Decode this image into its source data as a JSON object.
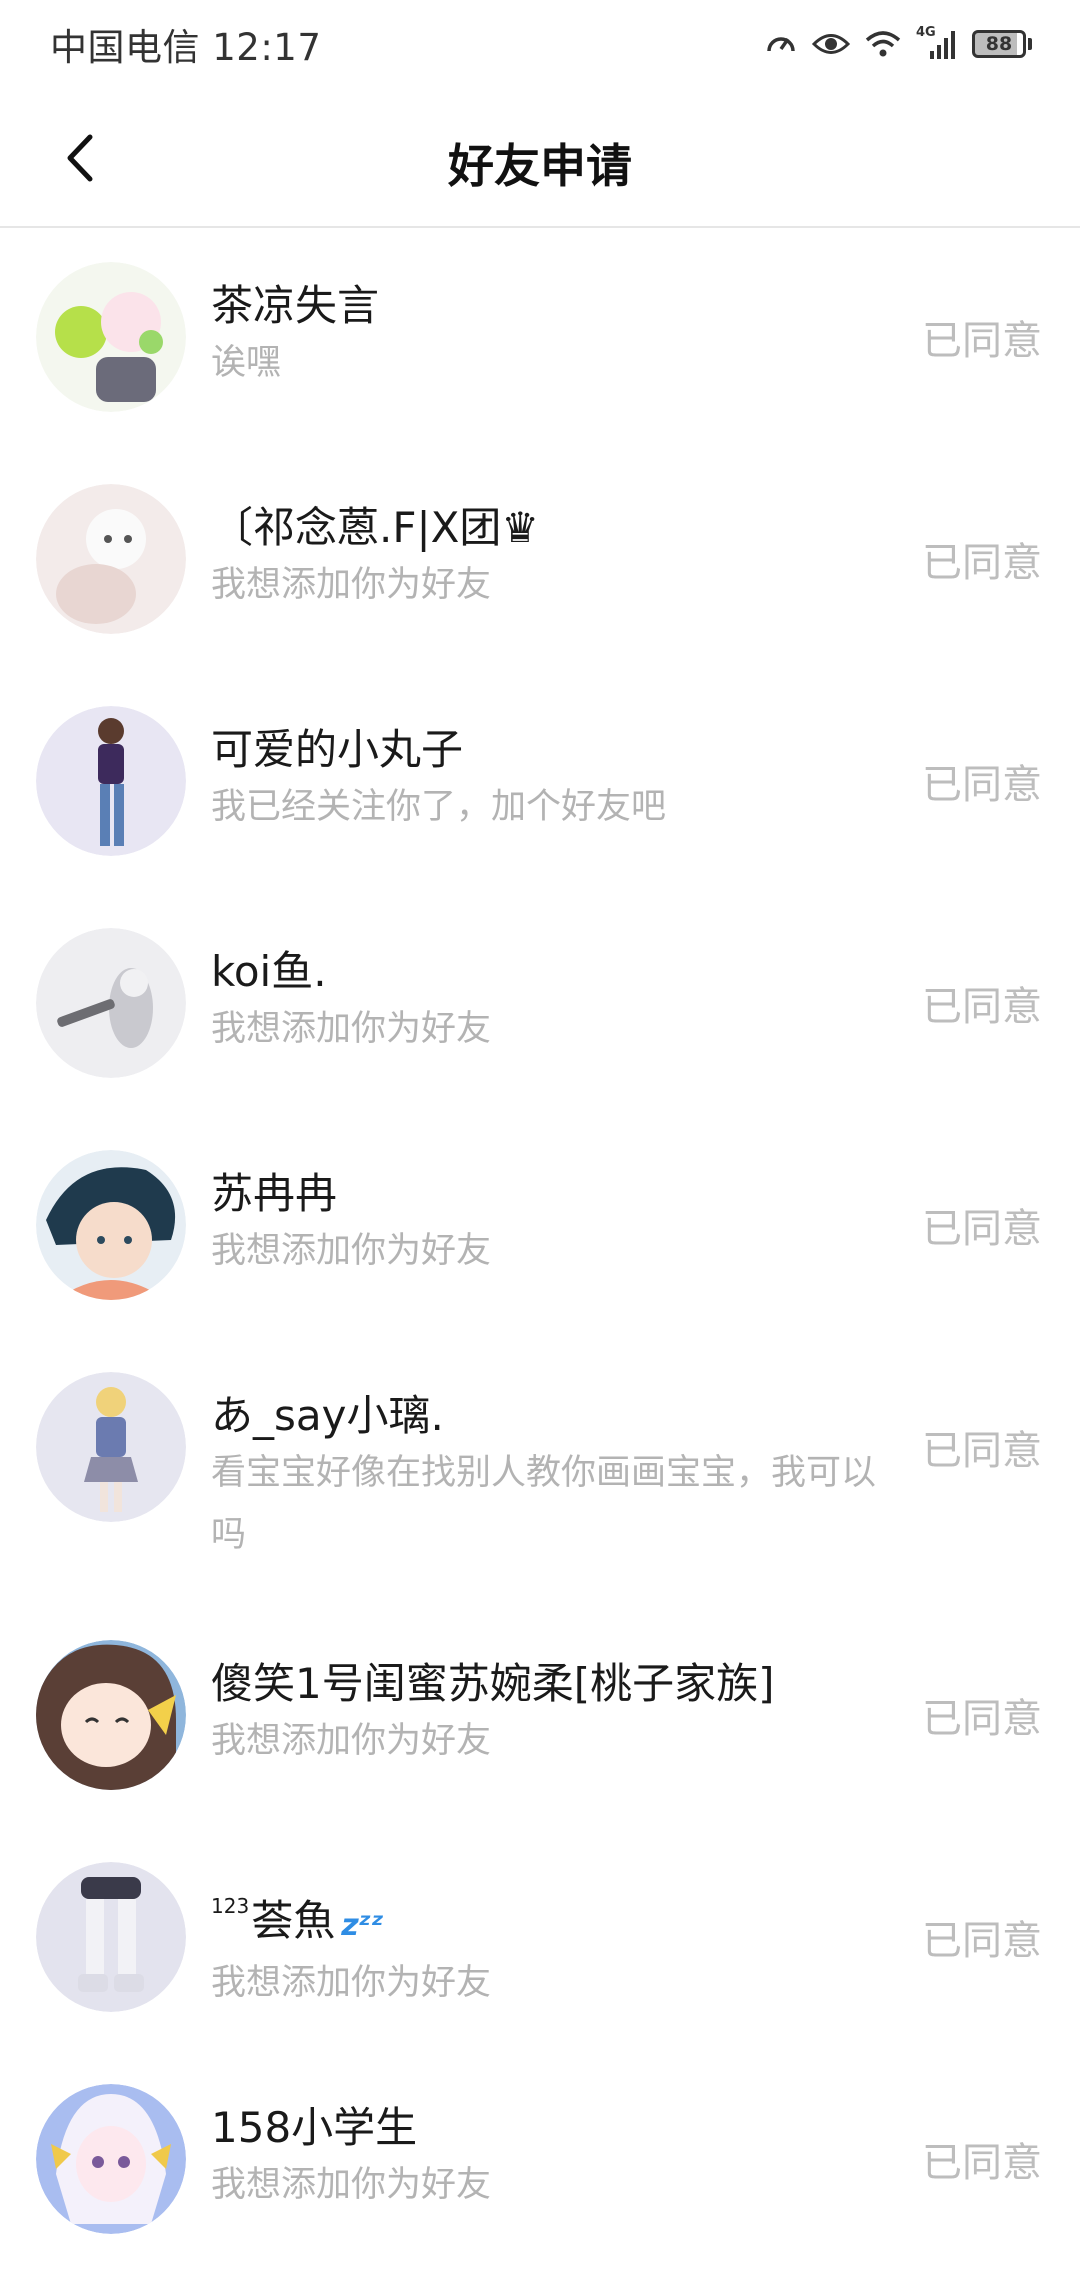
{
  "status_bar": {
    "carrier_time": "中国电信 12:17",
    "network": "4G",
    "battery": "88",
    "icons": [
      "speed-icon",
      "eye-icon",
      "wifi-icon",
      "signal-icon",
      "battery-icon"
    ]
  },
  "header": {
    "title": "好友申请",
    "back_icon": "chevron-left-icon"
  },
  "requests": [
    {
      "nick": "茶凉失言",
      "message": "诶嘿",
      "status": "已同意",
      "avatar_color": "#e9f3d7"
    },
    {
      "nick": "〔祁念蒽.F|X团♛",
      "message": "我想添加你为好友",
      "status": "已同意",
      "avatar_color": "#f1e6e6"
    },
    {
      "nick": "可爱的小丸子",
      "message": "我已经关注你了，加个好友吧",
      "status": "已同意",
      "avatar_color": "#e6e4f2"
    },
    {
      "nick": "koi鱼.",
      "message": "我想添加你为好友",
      "status": "已同意",
      "avatar_color": "#ececef"
    },
    {
      "nick": "苏冉冉",
      "message": "我想添加你为好友",
      "status": "已同意",
      "avatar_color": "#1f3a4d"
    },
    {
      "nick": "あ_say小璃.",
      "message": "看宝宝好像在找别人教你画画宝宝，我可以吗",
      "status": "已同意",
      "avatar_color": "#e4e4ef"
    },
    {
      "nick": "傻笑1号闺蜜苏婉柔[桃子家族]",
      "message": "我想添加你为好友",
      "status": "已同意",
      "avatar_color": "#9ec4e8"
    },
    {
      "nick_sup": "123",
      "nick": "荟魚",
      "nick_emoji": "zzz",
      "message": "我想添加你为好友",
      "status": "已同意",
      "avatar_color": "#e3e3ee"
    },
    {
      "nick": "158小学生",
      "message": "我想添加你为好友",
      "status": "已同意",
      "avatar_color": "#b9c9ee"
    }
  ]
}
